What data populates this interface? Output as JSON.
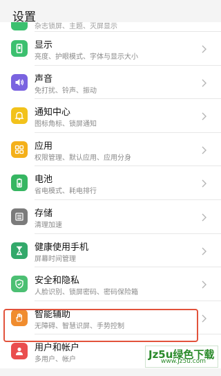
{
  "header": {
    "title": "设置"
  },
  "list": {
    "partial_sub": "杂志锁屏、主题、灭屏显示",
    "items": [
      {
        "label": "显示",
        "sub": "亮度、护眼模式、字体与显示大小",
        "icon": "display-icon",
        "color": "#3cc06f"
      },
      {
        "label": "声音",
        "sub": "免打扰、铃声、振动",
        "icon": "sound-icon",
        "color": "#7a63e0"
      },
      {
        "label": "通知中心",
        "sub": "图标角标、锁屏通知",
        "icon": "bell-icon",
        "color": "#f2c21b"
      },
      {
        "label": "应用",
        "sub": "权限管理、默认应用、应用分身",
        "icon": "apps-icon",
        "color": "#f4b01a"
      },
      {
        "label": "电池",
        "sub": "省电模式、耗电排行",
        "icon": "battery-icon",
        "color": "#36b662"
      },
      {
        "label": "存储",
        "sub": "清理加速",
        "icon": "storage-icon",
        "color": "#7b7b7b"
      },
      {
        "label": "健康使用手机",
        "sub": "屏幕时间管理",
        "icon": "hourglass-icon",
        "color": "#33a96b"
      },
      {
        "label": "安全和隐私",
        "sub": "人脸识别、锁屏密码、密码保险箱",
        "icon": "shield-icon",
        "color": "#4cbf73"
      },
      {
        "label": "智能辅助",
        "sub": "无障碍、智慧识屏、手势控制",
        "icon": "hand-icon",
        "color": "#f08c2e"
      },
      {
        "label": "用户和帐户",
        "sub": "多用户、帐户",
        "icon": "user-icon",
        "color": "#ea4e4e"
      }
    ]
  },
  "watermark": {
    "line1": "Jz5u绿色下载",
    "line2": "www.Jz5u.com"
  }
}
